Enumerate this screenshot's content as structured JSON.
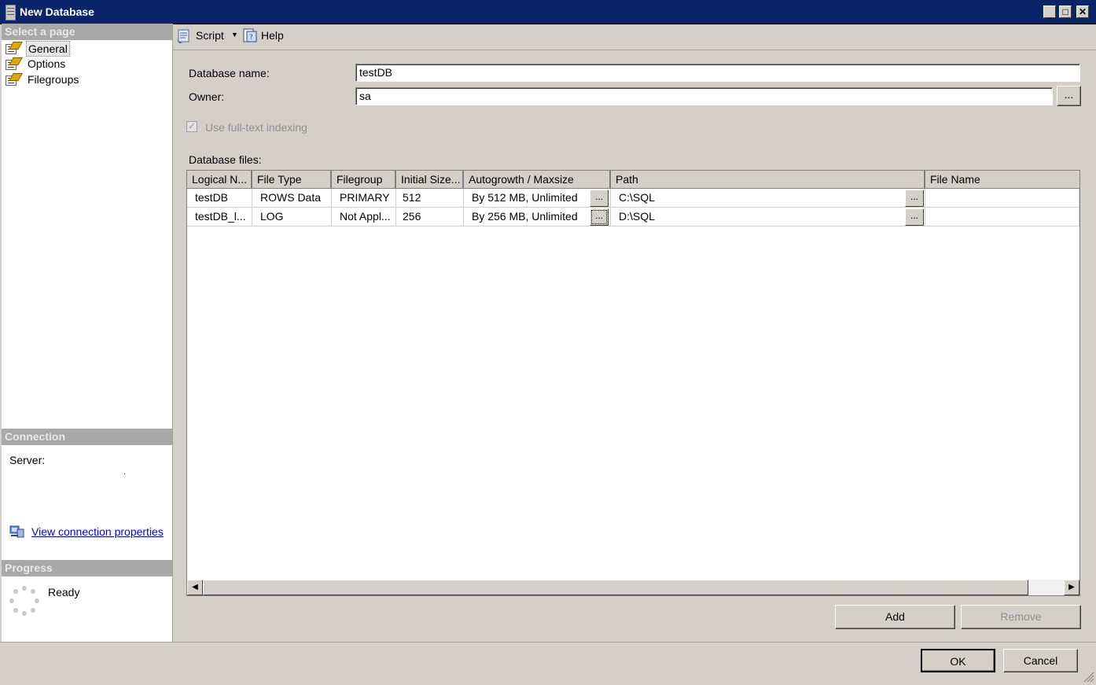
{
  "window": {
    "title": "New Database"
  },
  "left": {
    "select_page_header": "Select a page",
    "pages": [
      {
        "label": "General"
      },
      {
        "label": "Options"
      },
      {
        "label": "Filegroups"
      }
    ],
    "connection_header": "Connection",
    "server_label": "Server:",
    "server_value": ".",
    "view_connection_link": "View connection properties",
    "progress_header": "Progress",
    "progress_status": "Ready"
  },
  "toolbar": {
    "script_label": "Script",
    "help_label": "Help"
  },
  "form": {
    "database_name_label": "Database name:",
    "database_name_value": "testDB",
    "owner_label": "Owner:",
    "owner_value": "sa",
    "owner_browse": "...",
    "fulltext_label": "Use full-text indexing",
    "fulltext_checked": true,
    "files_label": "Database files:"
  },
  "grid": {
    "columns": [
      "Logical N...",
      "File Type",
      "Filegroup",
      "Initial Size...",
      "Autogrowth / Maxsize",
      "Path",
      "File Name"
    ],
    "rows": [
      {
        "logical": "testDB",
        "type": "ROWS Data",
        "filegroup": "PRIMARY",
        "size": "512",
        "autogrowth": "By 512 MB, Unlimited",
        "path": "C:\\SQL",
        "filename": ""
      },
      {
        "logical": "testDB_l...",
        "type": "LOG",
        "filegroup": "Not Appl...",
        "size": "256",
        "autogrowth": "By 256 MB, Unlimited",
        "path": "D:\\SQL",
        "filename": ""
      }
    ],
    "ellipsis": "..."
  },
  "buttons": {
    "add": "Add",
    "remove": "Remove",
    "ok": "OK",
    "cancel": "Cancel"
  }
}
